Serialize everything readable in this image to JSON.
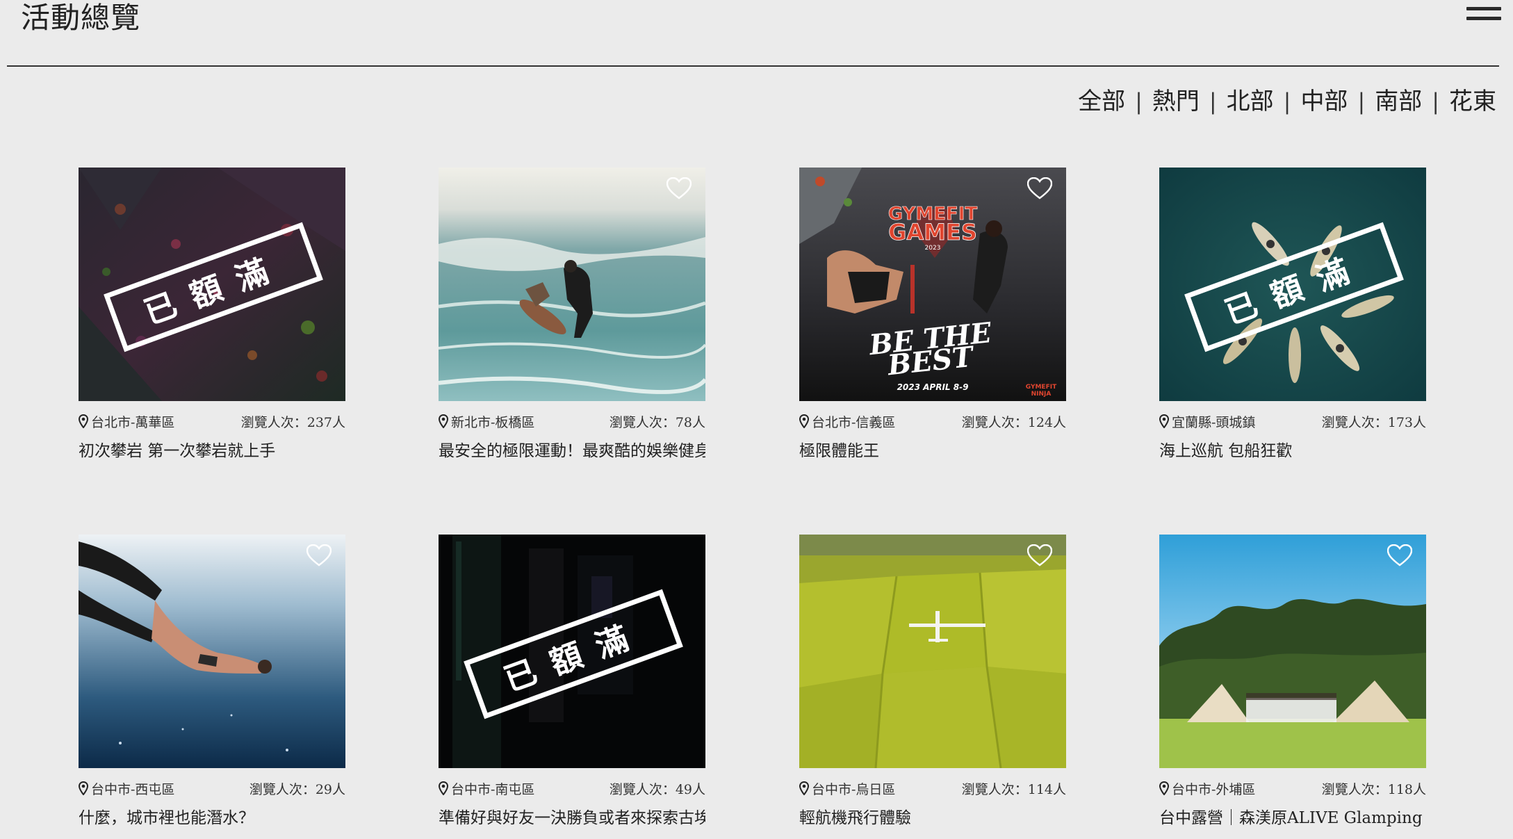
{
  "header": {
    "title": "活動總覽"
  },
  "filters": [
    {
      "label": "全部"
    },
    {
      "label": "熱門"
    },
    {
      "label": "北部"
    },
    {
      "label": "中部"
    },
    {
      "label": "南部"
    },
    {
      "label": "花東"
    }
  ],
  "stamp_text": "已額滿",
  "colors": {
    "background": "#ebebeb",
    "text": "#222222",
    "stamp": "#ffffff"
  },
  "cards": [
    {
      "location": "台北市-萬華區",
      "views": "瀏覽人次：237人",
      "title": "初次攀岩 第一次攀岩就上手",
      "full": true,
      "image": "indoor climbing wall"
    },
    {
      "location": "新北市-板橋區",
      "views": "瀏覽人次：78人",
      "title": "最安全的極限運動！最爽酷的娛樂健身",
      "full": false,
      "image": "surfing with dog"
    },
    {
      "location": "台北市-信義區",
      "views": "瀏覽人次：124人",
      "title": "極限體能王",
      "full": false,
      "image": "GYMEFIT GAMES poster",
      "poster": {
        "logo_line1": "GYMEFIT",
        "logo_line2": "GAMES",
        "year": "2023",
        "slogan_line1": "BE THE",
        "slogan_line2": "BEST",
        "date": "2023 APRIL 8-9",
        "brand_line1": "GYMEFIT",
        "brand_line2": "NINJA"
      }
    },
    {
      "location": "宜蘭縣-頭城鎮",
      "views": "瀏覽人次：173人",
      "title": "海上巡航 包船狂歡",
      "full": true,
      "image": "paddle boards from above"
    },
    {
      "location": "台中市-西屯區",
      "views": "瀏覽人次：29人",
      "title": "什麼，城市裡也能潛水？",
      "full": false,
      "image": "freediver underwater"
    },
    {
      "location": "台中市-南屯區",
      "views": "瀏覽人次：49人",
      "title": "準備好與好友一決勝負或者來探索古埃",
      "full": true,
      "image": "dark escape room"
    },
    {
      "location": "台中市-烏日區",
      "views": "瀏覽人次：114人",
      "title": "輕航機飛行體驗",
      "full": false,
      "image": "ultralight plane over rice fields"
    },
    {
      "location": "台中市-外埔區",
      "views": "瀏覽人次：118人",
      "title": "台中露營｜森渼原ALIVE Glamping B",
      "full": false,
      "image": "glamping tents on grass"
    }
  ]
}
